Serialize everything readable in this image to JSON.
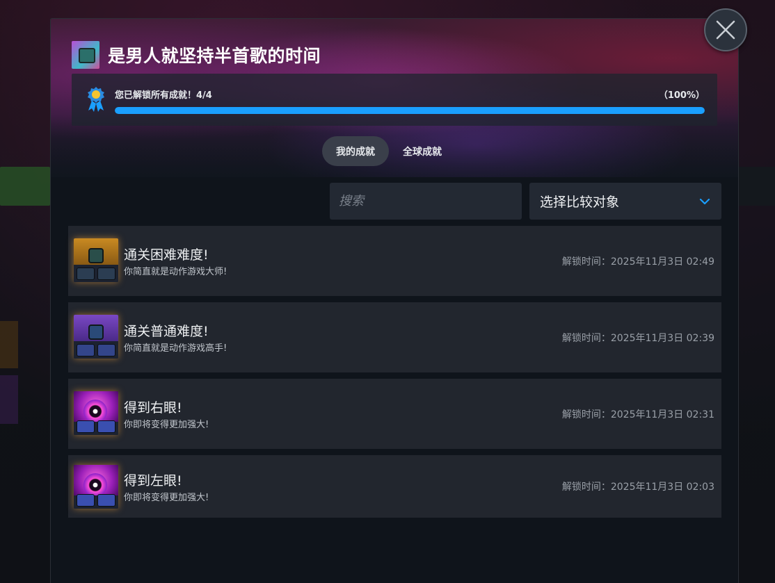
{
  "game": {
    "title": "是男人就坚持半首歌的时间",
    "icon": "game-avatar-icon"
  },
  "progress": {
    "label": "您已解锁所有成就！4/4",
    "percent_text": "（100%）",
    "unlocked": 4,
    "total": 4,
    "fraction": 1.0,
    "color": "#1a9fff"
  },
  "tabs": [
    {
      "label": "我的成就",
      "active": true
    },
    {
      "label": "全球成就",
      "active": false
    }
  ],
  "search": {
    "placeholder": "搜索",
    "value": ""
  },
  "compare": {
    "label": "选择比较对象",
    "accent": "#1a9fff"
  },
  "achievements": [
    {
      "name": "通关困难难度!",
      "description": "你简直就是动作游戏大师!",
      "time": "解锁时间：2025年11月3日 02:49",
      "icon": "hard-difficulty-icon",
      "theme": "#b8781c"
    },
    {
      "name": "通关普通难度!",
      "description": "你简直就是动作游戏高手!",
      "time": "解锁时间：2025年11月3日 02:39",
      "icon": "normal-difficulty-icon",
      "theme": "#6a3fb0"
    },
    {
      "name": "得到右眼!",
      "description": "你即将变得更加强大!",
      "time": "解锁时间：2025年11月3日 02:31",
      "icon": "right-eye-icon",
      "theme": "#c023d0"
    },
    {
      "name": "得到左眼!",
      "description": "你即将变得更加强大!",
      "time": "解锁时间：2025年11月3日 02:03",
      "icon": "left-eye-icon",
      "theme": "#c023d0"
    }
  ],
  "close": {
    "icon": "close-icon"
  }
}
